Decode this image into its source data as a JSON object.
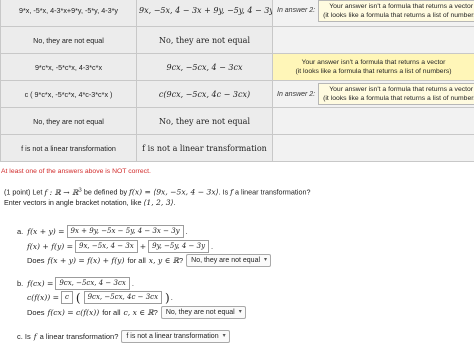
{
  "results_table": {
    "rows": [
      {
        "entered": "9*x, -5*x, 4-3*x+9*y, -5*y, 4-3*y",
        "preview": "9x, −5x, 4 − 3x + 9y, −5y, 4 − 3y",
        "message": {
          "label": "In answer 2:",
          "line1": "Your answer isn't a formula that returns a vector",
          "line2": "(it looks like a formula that returns a list of numbers)"
        },
        "highlight": false
      },
      {
        "entered": "No, they are not equal",
        "preview": "No, they are not equal",
        "message": null,
        "highlight": false
      },
      {
        "entered": "9*c*x, -5*c*x, 4-3*c*x",
        "preview": "9cx, −5cx, 4 − 3cx",
        "message": {
          "label": "",
          "line1": "Your answer isn't a formula that returns a vector",
          "line2": "(it looks like a formula that returns a list of numbers)"
        },
        "highlight": true
      },
      {
        "entered": "c ( 9*c*x, -5*c*x, 4*c-3*c*x )",
        "preview": "c(9cx, −5cx, 4c − 3cx)",
        "message": {
          "label": "In answer 2:",
          "line1": "Your answer isn't a formula that returns a vector",
          "line2": "(it looks like a formula that returns a list of numbers)"
        },
        "highlight": false
      },
      {
        "entered": "No, they are not equal",
        "preview": "No, they are not equal",
        "message": null,
        "highlight": false
      },
      {
        "entered": "f is not a linear transformation",
        "preview": "f is not a linear transformation",
        "message": null,
        "highlight": false
      }
    ]
  },
  "warning": "At least one of the answers above is NOT correct.",
  "question": {
    "intro_1": "(1 point) Let",
    "f_map": "f : ℝ → ℝ",
    "sup": "3",
    "intro_2": "be defined by",
    "f_def": "f(x) = ⟨9x, −5x, 4 − 3x⟩",
    "intro_3": ". Is",
    "f": "f",
    "intro_4": "a linear transformation?",
    "line2": "Enter vectors in angle bracket notation, like",
    "example": "⟨1, 2, 3⟩",
    "period": "."
  },
  "part_a": {
    "label": "a.",
    "lhs1": "f(x + y) =",
    "box1": "9x + 9y, −5x − 5y, 4 − 3x − 3y",
    "lhs2": "f(x) + f(y) =",
    "box2a": "9x, −5x, 4 − 3x",
    "plus": "+",
    "box2b": "9y, −5y, 4 − 3y",
    "q_pre": "Does",
    "q_math": "f(x + y) = f(x) + f(y)",
    "q_mid": "for all",
    "q_math2": "x, y ∈ ℝ",
    "q_end": "?",
    "select": "No, they are not equal"
  },
  "part_b": {
    "label": "b.",
    "lhs1": "f(cx) =",
    "box1": "9cx, −5cx, 4 − 3cx",
    "lhs2": "c(f(x)) =",
    "box2c": "c",
    "box2": "9cx, −5cx, 4c − 3cx",
    "q_pre": "Does",
    "q_math": "f(cx) = c(f(x))",
    "q_mid": "for all",
    "q_math2": "c, x ∈ ℝ",
    "q_end": "?",
    "select": "No, they are not equal"
  },
  "part_c": {
    "label": "c. Is",
    "f": "f",
    "q": "a linear transformation?",
    "select": "f is not a linear transformation"
  }
}
